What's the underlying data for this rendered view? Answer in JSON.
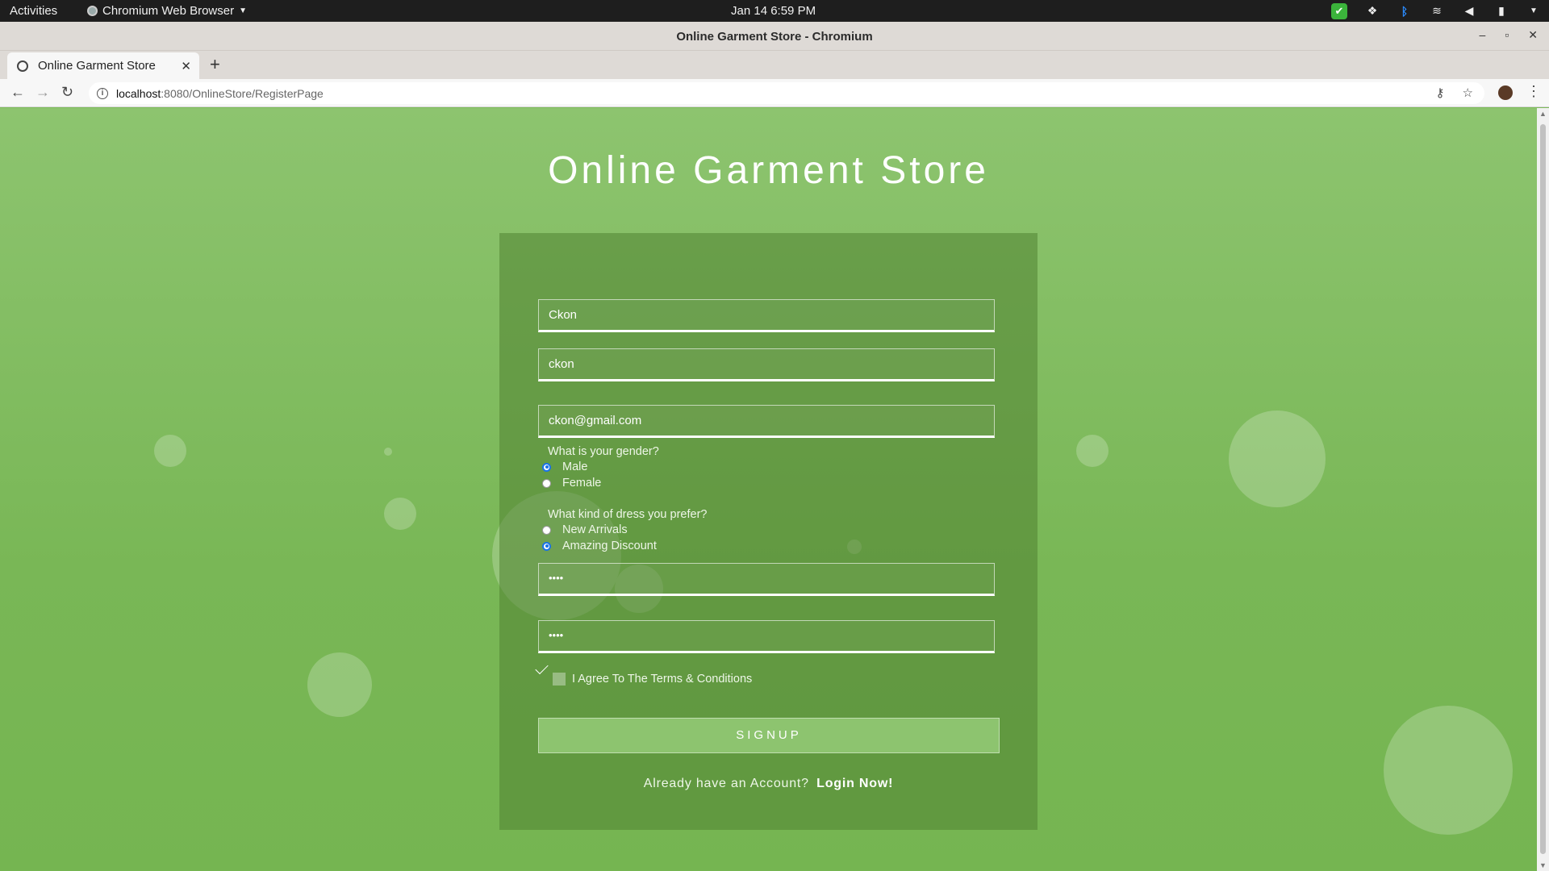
{
  "topbar": {
    "activities": "Activities",
    "app_name": "Chromium Web Browser",
    "clock": "Jan 14  6:59 PM"
  },
  "window": {
    "title": "Online Garment Store - Chromium"
  },
  "tab": {
    "title": "Online Garment Store"
  },
  "address": {
    "host": "localhost",
    "path": ":8080/OnlineStore/RegisterPage"
  },
  "page": {
    "title": "Online Garment Store",
    "form": {
      "name_value": "Ckon",
      "username_value": "ckon",
      "email_value": "ckon@gmail.com",
      "gender_question": "What is your gender?",
      "gender_options": [
        "Male",
        "Female"
      ],
      "gender_selected": "Male",
      "dress_question": "What kind of dress you prefer?",
      "dress_options": [
        "New Arrivals",
        "Amazing Discount"
      ],
      "dress_selected": "Amazing Discount",
      "password_value": "••••",
      "confirm_password_value": "••••",
      "agree_label": "I Agree To The Terms & Conditions",
      "agree_checked": true,
      "signup_label": "SIGNUP",
      "account_prompt": "Already have an Account?",
      "login_link": "Login Now!"
    }
  },
  "colors": {
    "background": "#7cba59",
    "card": "#5f9a45",
    "button": "#8dc46f",
    "radio_checked": "#1a73e8"
  }
}
